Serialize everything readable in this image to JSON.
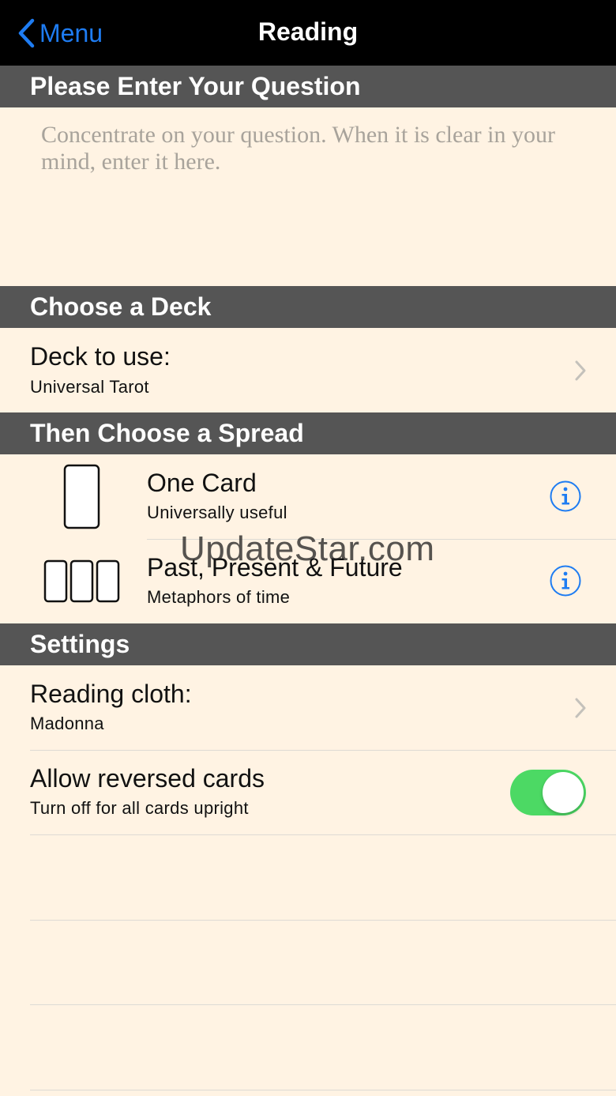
{
  "nav": {
    "back_label": "Menu",
    "title": "Reading"
  },
  "question": {
    "header": "Please Enter Your Question",
    "placeholder": "Concentrate on your question. When it is clear in your mind, enter it here.",
    "value": ""
  },
  "deck": {
    "header": "Choose a Deck",
    "title": "Deck to use:",
    "value": "Universal Tarot"
  },
  "spread": {
    "header": "Then Choose a Spread",
    "items": [
      {
        "title": "One Card",
        "subtitle": "Universally useful",
        "icon": "single-card-icon"
      },
      {
        "title": "Past, Present & Future",
        "subtitle": "Metaphors of time",
        "icon": "three-cards-icon"
      }
    ]
  },
  "settings": {
    "header": "Settings",
    "cloth_title": "Reading cloth:",
    "cloth_value": "Madonna",
    "reversed_title": "Allow reversed cards",
    "reversed_subtitle": "Turn off for all cards upright",
    "reversed_on": true
  },
  "watermark": "UpdateStar.com",
  "colors": {
    "nav_bg": "#000000",
    "accent": "#1e7cf2",
    "section_bg": "#555555",
    "content_bg": "#fff3e3",
    "toggle_on": "#4cd964"
  }
}
